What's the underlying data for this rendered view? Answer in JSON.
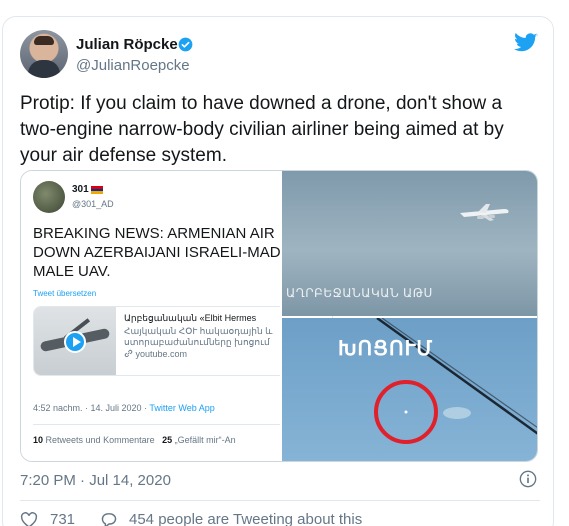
{
  "author": {
    "name": "Julian Röpcke",
    "handle": "@JulianRoepcke"
  },
  "tweet": {
    "text": "Protip: If you claim to have downed a drone, don't show a two-engine narrow-body civilian airliner being aimed at by your air defense system.",
    "timestamp": "7:20 PM · Jul 14, 2020"
  },
  "quoted": {
    "name": "301",
    "handle": "@301_AD",
    "headline_lines": [
      "BREAKING NEWS: ARMENIAN AIR D",
      "DOWN AZERBAIJANI ISRAELI-MADI",
      "MALE UAV."
    ],
    "translate": "Tweet übersetzen",
    "link_card": {
      "title": "Արբեցանական «Elbit Hermes",
      "desc_line1": "Հայկական ՀՕՒ հակաօդային և",
      "desc_line2": "ստորաբաժանումները խոցում",
      "url": "youtube.com"
    },
    "meta_time": "4:52 nachm. · 14. Juli 2020 · ",
    "meta_app": "Twitter Web App",
    "retweets_count": "10",
    "retweets_label": "Retweets und Kommentare",
    "likes_count": "25",
    "likes_label": "„Gefällt mir“-An",
    "image_top_caption": "ԱՂՐԲԵՋԱՆԱԿԱՆ ԱԹՍ",
    "image_bottom_caption": "ԽՈՑՈՒՄ"
  },
  "actions": {
    "likes": "731",
    "tweeting": "454 people are Tweeting about this"
  },
  "colors": {
    "accent": "#1da1f2",
    "muted": "#657786",
    "target_circle": "#e0202a"
  },
  "icons": [
    "verified-badge-icon",
    "twitter-bird-icon",
    "play-icon",
    "link-icon",
    "info-icon",
    "heart-icon",
    "reply-bubble-icon"
  ]
}
